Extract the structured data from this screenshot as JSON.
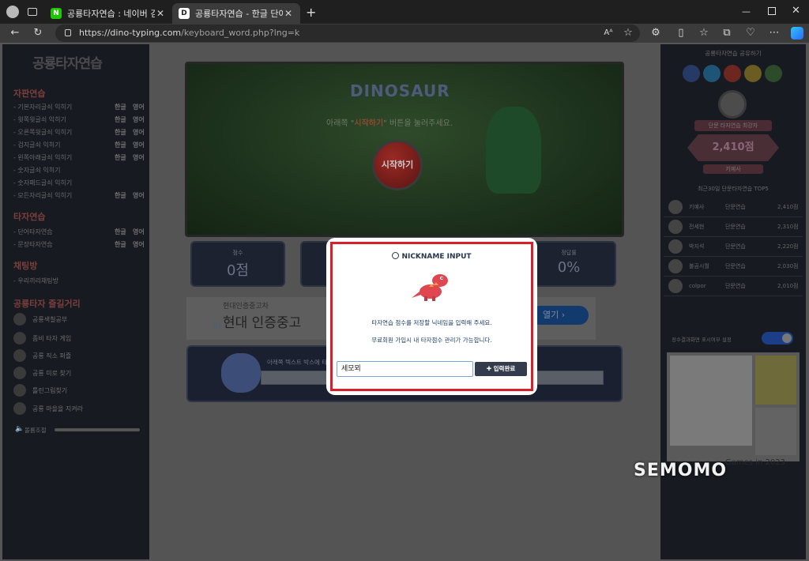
{
  "browser": {
    "tabs": [
      {
        "label": "공룡타자연습 : 네이버 검색",
        "favicon": "N",
        "active": false
      },
      {
        "label": "공룡타자연습 - 한글 단어 타자연",
        "favicon": "D",
        "active": true
      }
    ],
    "url_host": "https://dino-typing.com",
    "url_path": "/keyboard_word.php?lng=k"
  },
  "left": {
    "logo": "공룡타자연습",
    "sections": [
      {
        "title": "자판연습",
        "items": [
          {
            "label": "- 기본자리글쇠 익히기",
            "ko": "한글",
            "en": "영어"
          },
          {
            "label": "- 윗쪽윗글쇠 익히기",
            "ko": "한글",
            "en": "영어"
          },
          {
            "label": "- 오른쪽윗글쇠 익히기",
            "ko": "한글",
            "en": "영어"
          },
          {
            "label": "- 검지글쇠 익히기",
            "ko": "한글",
            "en": "영어"
          },
          {
            "label": "- 왼쪽아래글쇠 익히기",
            "ko": "한글",
            "en": "영어"
          },
          {
            "label": "- 숫자글쇠 익히기",
            "ko": "",
            "en": ""
          },
          {
            "label": "- 숫자패드글쇠 익히기",
            "ko": "",
            "en": ""
          },
          {
            "label": "- 모든자리글쇠 익히기",
            "ko": "한글",
            "en": "영어"
          }
        ]
      },
      {
        "title": "타자연습",
        "items": [
          {
            "label": "- 단어타자연습",
            "ko": "한글",
            "en": "영어"
          },
          {
            "label": "- 문장타자연습",
            "ko": "한글",
            "en": "영어"
          }
        ]
      },
      {
        "title": "채팅방",
        "items": [
          {
            "label": "- 우리끼리채팅방",
            "ko": "",
            "en": ""
          }
        ]
      }
    ],
    "fun_title": "공룡타자 즐길거리",
    "fun_items": [
      "공룡색칠공부",
      "좀비 타자 게임",
      "공룡 직소 퍼즐",
      "공룡 미로 찾기",
      "틀린그림찾기",
      "공룡 마을을 지켜라"
    ],
    "volume_label": "볼륨조절"
  },
  "game": {
    "title": "DINOSAUR",
    "instruction_pre": "아래쪽 \"",
    "instruction_highlight": "시작하기",
    "instruction_post": "\" 버튼을 눌러주세요.",
    "start_button": "시작하기"
  },
  "stats": [
    {
      "label": "점수",
      "value": "0점"
    },
    {
      "label": "정답률",
      "value": "0%"
    }
  ],
  "ad": {
    "small": "현대인증중고차",
    "big": "현대 인증중고",
    "button": "열기"
  },
  "typing_hint": "아래쪽 텍스트 박스에 타이핑후 엔터키를 누르세요.",
  "right": {
    "share_title": "공룡타자연습 공유하기",
    "best_label": "단문 타자연습 최강자",
    "best_score": "2,410점",
    "best_name": "키예사",
    "tops_title": "최근30일 단문타자연습 TOP5",
    "tops": [
      {
        "name": "키예사",
        "type": "단문연습",
        "score": "2,410점"
      },
      {
        "name": "전세현",
        "type": "단문연습",
        "score": "2,310점"
      },
      {
        "name": "박지석",
        "type": "단문연습",
        "score": "2,220점"
      },
      {
        "name": "불곰시월",
        "type": "단문연습",
        "score": "2,030점"
      },
      {
        "name": "colpor",
        "type": "단문연습",
        "score": "2,010점"
      }
    ],
    "setting_label": "정수결과화면 표시여부 설정",
    "ad_text": "Games in 2023"
  },
  "modal": {
    "title": "NICKNAME INPUT",
    "line1": "타자연습 점수를 저장할 닉네임을 입력해 주세요.",
    "line2": "무료회원 가입시 내 타자점수 관리가 가능합니다.",
    "input_value": "세모뫼",
    "submit": "✚ 입력완료"
  },
  "watermark": "SEMOMO"
}
